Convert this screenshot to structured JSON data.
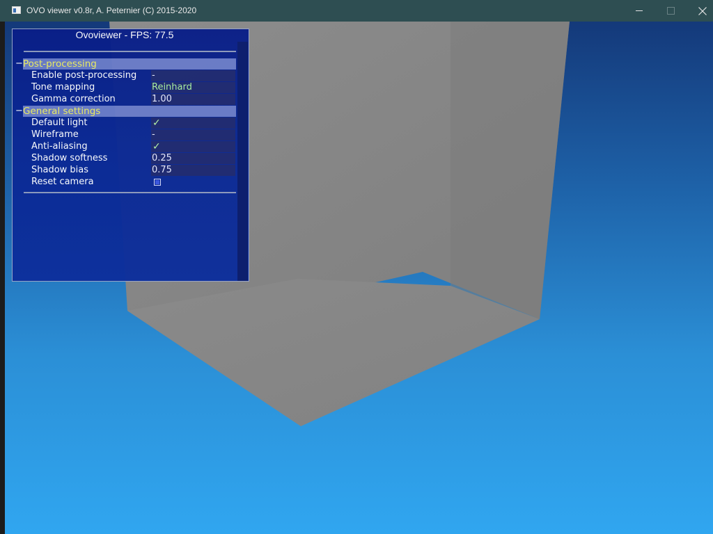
{
  "window": {
    "title": "OVO viewer v0.8r, A. Peternier (C) 2015-2020",
    "controls": {
      "minimize_icon": "minimize-icon",
      "maximize_icon": "maximize-icon",
      "close_icon": "close-icon",
      "close_glyph": "✕"
    }
  },
  "panel": {
    "title": "Ovoviewer - FPS: 77.5",
    "sections": [
      {
        "toggle": "−",
        "label": "Post-processing",
        "rows": [
          {
            "label": "Enable post-processing",
            "value": "-"
          },
          {
            "label": "Tone mapping",
            "value": "Reinhard"
          },
          {
            "label": "Gamma correction",
            "value": "1.00"
          }
        ]
      },
      {
        "toggle": "−",
        "label": "General settings",
        "rows": [
          {
            "label": "Default light",
            "value": "✓",
            "icon": "checkmark-icon"
          },
          {
            "label": "Wireframe",
            "value": "-"
          },
          {
            "label": "Anti-aliasing",
            "value": "✓",
            "icon": "checkmark-icon"
          },
          {
            "label": "Shadow softness",
            "value": "0.25"
          },
          {
            "label": "Shadow bias",
            "value": "0.75"
          },
          {
            "label": "Reset camera",
            "value": "",
            "icon": "button-box-icon"
          }
        ]
      }
    ]
  },
  "colors": {
    "titlebar": "#2e4e52",
    "panel_bg": "#0c2a95",
    "section_bar": "#6a7cc8",
    "section_text": "#f0f060",
    "value_green": "#a8f0a0",
    "sky_top": "#14397a",
    "sky_bottom": "#30a6f0",
    "cube_gray": "#8a8a8a"
  }
}
